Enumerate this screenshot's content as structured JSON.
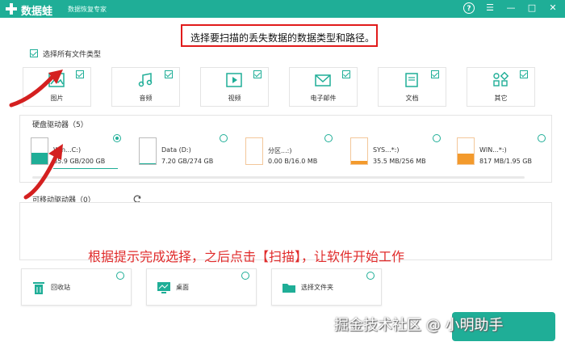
{
  "app": {
    "name": "数据蛙",
    "subtitle": "数据恢复专家"
  },
  "window": {
    "help": "?",
    "menu": "☰",
    "minimize": "—",
    "maximize": "□",
    "close": "✕"
  },
  "instruction": "选择要扫描的丢失数据的数据类型和路径。",
  "select_all": {
    "label": "选择所有文件类型",
    "checked": true
  },
  "file_types": [
    {
      "label": "图片",
      "checked": true,
      "icon": "image-icon"
    },
    {
      "label": "音频",
      "checked": true,
      "icon": "music-icon"
    },
    {
      "label": "视频",
      "checked": true,
      "icon": "video-icon"
    },
    {
      "label": "电子邮件",
      "checked": true,
      "icon": "mail-icon"
    },
    {
      "label": "文档",
      "checked": true,
      "icon": "document-icon"
    },
    {
      "label": "其它",
      "checked": true,
      "icon": "other-icon"
    }
  ],
  "hard_drives": {
    "title": "硬盘驱动器（5）",
    "items": [
      {
        "name": "Win...C:)",
        "size": "85.9 GB/200 GB",
        "selected": true,
        "fill": 0.43,
        "color": "#1fae97"
      },
      {
        "name": "Data (D:)",
        "size": "7.20 GB/274 GB",
        "selected": false,
        "fill": 0.03,
        "color": "#1fae97"
      },
      {
        "name": "分区...:)",
        "size": "0.00  B/16.0 MB",
        "selected": false,
        "fill": 0.0,
        "color": "#f39a2c"
      },
      {
        "name": "SYS...*:)",
        "size": "35.5 MB/256 MB",
        "selected": false,
        "fill": 0.14,
        "color": "#f39a2c"
      },
      {
        "name": "WIN...*:)",
        "size": "817 MB/1.95 GB",
        "selected": false,
        "fill": 0.42,
        "color": "#f39a2c"
      }
    ]
  },
  "removable": {
    "title": "可移动驱动器（0）"
  },
  "bottom_options": [
    {
      "label": "回收站",
      "icon": "recycle-bin-icon"
    },
    {
      "label": "桌面",
      "icon": "desktop-icon"
    },
    {
      "label": "选择文件夹",
      "icon": "folder-icon"
    }
  ],
  "overlay_hint": "根据提示完成选择，之后点击【扫描】，让软件开始工作",
  "watermark": "掘金技术社区 @ 小明助手",
  "colors": {
    "accent": "#1fae97",
    "highlight": "#e11b1b",
    "drive_small": "#f39a2c"
  }
}
